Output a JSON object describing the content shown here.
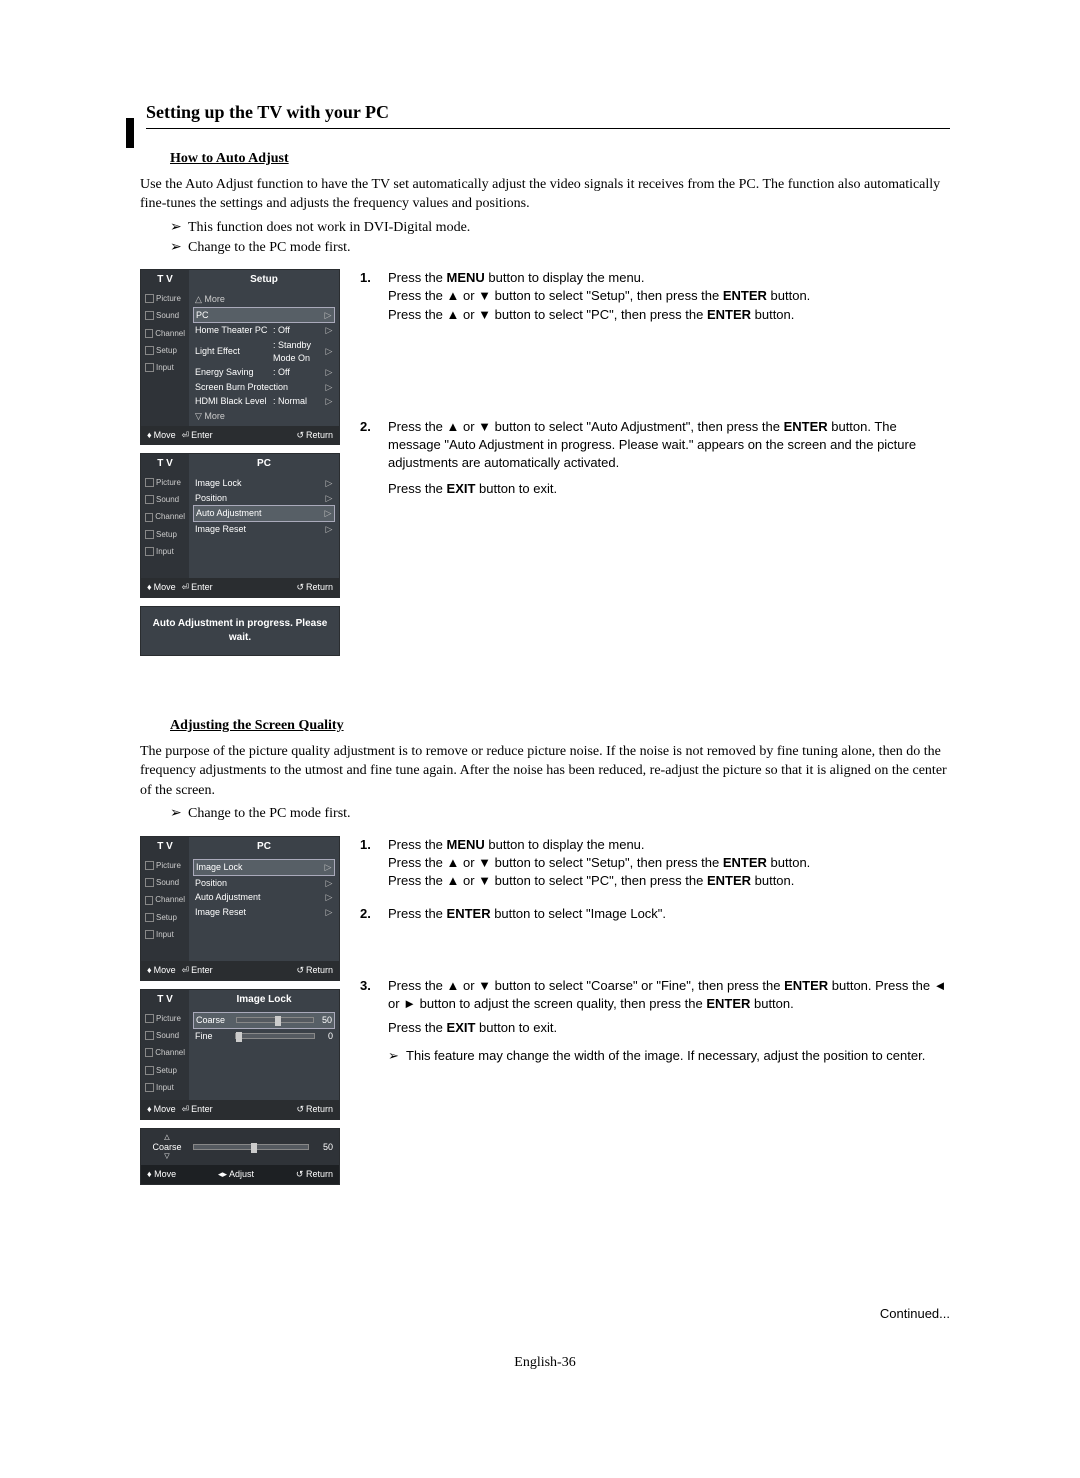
{
  "title": "Setting up the TV with your PC",
  "section1": {
    "heading": "How to Auto Adjust",
    "para": "Use the Auto Adjust function to have the TV set automatically adjust the video signals it receives from the PC. The function also automatically fine-tunes the settings and adjusts the frequency values and positions.",
    "notes": [
      "This function does not work in DVI-Digital mode.",
      "Change to the PC mode first."
    ],
    "steps": [
      {
        "num": "1.",
        "lines": [
          "Press the MENU button to display the menu.",
          "Press the ▲ or ▼ button to select \"Setup\", then press the ENTER button.",
          "Press the ▲ or ▼ button to select \"PC\", then press the ENTER button."
        ]
      },
      {
        "num": "2.",
        "lines": [
          "Press the ▲ or ▼ button to select \"Auto Adjustment\", then press the ENTER button. The message \"Auto Adjustment in progress. Please wait.\" appears on the screen and the picture adjustments are automatically activated.",
          "Press the EXIT button to exit."
        ]
      }
    ]
  },
  "osd1": {
    "tv": "T V",
    "title": "Setup",
    "side": [
      "Picture",
      "Sound",
      "Channel",
      "Setup",
      "Input"
    ],
    "more_top": "△ More",
    "rows": [
      {
        "label": "PC",
        "val": "",
        "hl": true,
        "tri": "▷"
      },
      {
        "label": "Home Theater PC",
        "val": ": Off",
        "tri": "▷"
      },
      {
        "label": "Light Effect",
        "val": ": Standby Mode On",
        "tri": "▷"
      },
      {
        "label": "Energy Saving",
        "val": ": Off",
        "tri": "▷"
      },
      {
        "label": "Screen Burn Protection",
        "val": "",
        "tri": "▷"
      },
      {
        "label": "HDMI Black Level",
        "val": ": Normal",
        "tri": "▷"
      }
    ],
    "more_bot": "▽ More",
    "footer": {
      "move": "Move",
      "enter": "Enter",
      "return": "Return"
    }
  },
  "osd2": {
    "tv": "T V",
    "title": "PC",
    "side": [
      "Picture",
      "Sound",
      "Channel",
      "Setup",
      "Input"
    ],
    "rows": [
      {
        "label": "Image Lock",
        "tri": "▷"
      },
      {
        "label": "Position",
        "tri": "▷"
      },
      {
        "label": "Auto Adjustment",
        "tri": "▷",
        "hl": true
      },
      {
        "label": "Image Reset",
        "tri": "▷"
      }
    ],
    "footer": {
      "move": "Move",
      "enter": "Enter",
      "return": "Return"
    }
  },
  "osd_msg": "Auto Adjustment in progress. Please wait.",
  "section2": {
    "heading": "Adjusting the Screen Quality",
    "para": "The purpose of the picture quality adjustment is to remove or reduce picture noise. If the noise is not removed by fine tuning alone, then do the frequency adjustments to the utmost and fine tune again. After the noise has been reduced, re-adjust the picture so that it is aligned on the center of the screen.",
    "notes": [
      "Change to the PC mode first."
    ],
    "steps": [
      {
        "num": "1.",
        "lines": [
          "Press the MENU button to display the menu.",
          "Press the ▲ or ▼ button to select \"Setup\", then press the ENTER button.",
          "Press the ▲ or ▼ button to select \"PC\", then press the ENTER button."
        ]
      },
      {
        "num": "2.",
        "lines": [
          "Press the ENTER button to select \"Image Lock\"."
        ]
      },
      {
        "num": "3.",
        "lines": [
          "Press the ▲ or ▼ button to select \"Coarse\" or \"Fine\", then press the ENTER button. Press the ◄ or ► button to adjust the screen quality, then press the ENTER button.",
          "Press the EXIT button to exit."
        ],
        "note": "This feature may change the width of the image. If necessary, adjust the position to center."
      }
    ]
  },
  "osd3": {
    "tv": "T V",
    "title": "PC",
    "side": [
      "Picture",
      "Sound",
      "Channel",
      "Setup",
      "Input"
    ],
    "rows": [
      {
        "label": "Image Lock",
        "tri": "▷",
        "hl": true
      },
      {
        "label": "Position",
        "tri": "▷"
      },
      {
        "label": "Auto Adjustment",
        "tri": "▷"
      },
      {
        "label": "Image Reset",
        "tri": "▷"
      }
    ],
    "footer": {
      "move": "Move",
      "enter": "Enter",
      "return": "Return"
    }
  },
  "osd4": {
    "tv": "T V",
    "title": "Image Lock",
    "side": [
      "Picture",
      "Sound",
      "Channel",
      "Setup",
      "Input"
    ],
    "rows": [
      {
        "label": "Coarse",
        "val": "50",
        "slider": 0.5,
        "hl": true
      },
      {
        "label": "Fine",
        "val": "0",
        "slider": 0.0
      }
    ],
    "footer": {
      "move": "Move",
      "enter": "Enter",
      "return": "Return"
    }
  },
  "osd5": {
    "label": "Coarse",
    "value": "50",
    "slider": 0.5,
    "footer": {
      "move": "Move",
      "adjust": "Adjust",
      "return": "Return"
    }
  },
  "btns": {
    "menu": "MENU",
    "enter": "ENTER",
    "exit": "EXIT"
  },
  "footer_text": "Continued...",
  "page_num": "English-36"
}
